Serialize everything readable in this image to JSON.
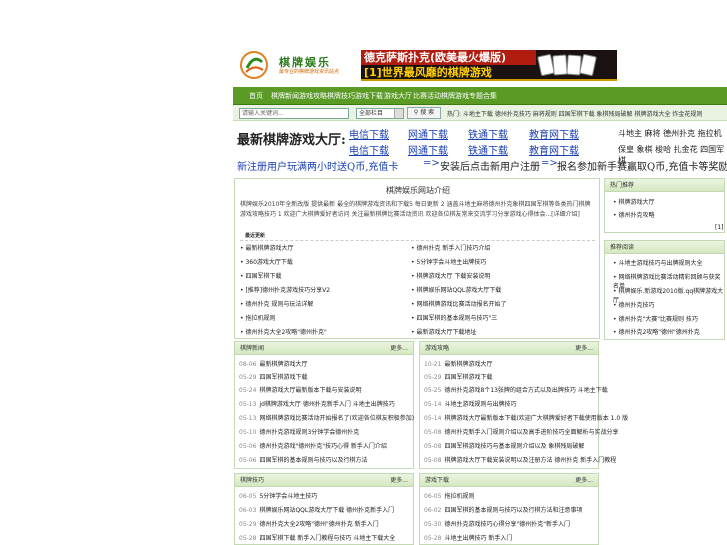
{
  "logo": {
    "name": "棋牌娱乐",
    "tagline": "最专业的棋牌游戏资讯站点"
  },
  "banner": {
    "line1": "德克萨斯扑克(欧美最火爆版)",
    "line2": "[1]世界最风靡的棋牌游戏"
  },
  "nav": {
    "items": [
      "首页",
      "棋牌新闻",
      "游戏攻略",
      "棋牌技巧",
      "游戏下载",
      "游戏大厅",
      "比赛活动",
      "棋牌游戏",
      "专题合集"
    ]
  },
  "search": {
    "placeholder": "请输入关键词...",
    "select_value": "全部栏目",
    "button": "搜 索",
    "hot": "热门: 斗地主下载 德州扑克技巧 麻将规则 四国军棋下载 象棋残局破解 棋牌游戏大全 炸金花规则"
  },
  "downloads": {
    "title": "最新棋牌游戏大厅:",
    "links": [
      "电信下载",
      "网通下载",
      "铁通下载",
      "教育网下载",
      "电信下载",
      "网通下载",
      "铁通下载",
      "教育网下载"
    ],
    "games_row1": "斗地主  麻将  德州扑克  拖拉机",
    "games_row2": "保皇  象棋  梭哈  扎金花  四国军棋"
  },
  "promo": {
    "p1": "新注册用户玩满两小时送Q币,充值卡",
    "arrow": "=>",
    "p2": "安装后点击新用户注册",
    "p3": "报名参加新手赛赢取Q币,充值卡等奖励"
  },
  "intro": {
    "title": "棋牌娱乐网站介绍",
    "text": "棋牌娱乐2010年全新改版 提供最新 最全的棋牌游戏资讯和下载5 每日更新 2 涵盖斗地主麻将德州扑克象棋四国军棋等各类热门棋牌游戏攻略技巧 1 欢迎广大棋牌爱好者访问 关注最新棋牌比赛活动资讯 欢迎各位棋友常来交流学习分享游戏心得体会...[详细介绍]",
    "recent_title": "最近更新",
    "recent": [
      "最新棋牌游戏大厅",
      "德州扑克 新手入门技巧介绍",
      "360游戏大厅下载",
      "5分钟学会斗地主出牌技巧",
      "四国军棋下载",
      "棋牌游戏大厅 下载安装说明",
      "[推荐]德州扑克游戏技巧分享V2",
      "棋牌娱乐网站QQL游戏大厅下载",
      "德州扑克 规则与玩法详解",
      "网络棋牌游戏比赛活动报名开始了",
      "拖拉机规则",
      "四国军棋的基本规则与技巧\"三",
      "德州扑克大全2攻略\"德州扑克\"",
      "最新游戏大厅下载地址"
    ]
  },
  "right1": {
    "title": "热门推荐",
    "items": [
      "棋牌游戏大厅",
      "德州扑克攻略"
    ],
    "page": "[1]"
  },
  "right2": {
    "title": "推荐阅读",
    "items": [
      "斗地主游戏技巧与出牌规则大全",
      "网络棋牌游戏比赛活动精彩回顾与获奖名单",
      "棋牌娱乐.新游戏2010版.qq棋牌游戏大厅",
      "德州扑克技巧",
      "德州扑克\"大赛\"比赛规则 技巧",
      "德州扑克2攻略\"德州\"德州扑克"
    ]
  },
  "news1": {
    "title": "棋牌新闻",
    "more": "更多...",
    "rows": [
      {
        "date": "08-06",
        "text": "最新棋牌游戏大厅"
      },
      {
        "date": "05-29",
        "text": "四国军棋游戏下载"
      },
      {
        "date": "05-24",
        "text": "棋牌游戏大厅最新版本下载与安装说明"
      },
      {
        "date": "05-13",
        "text": "jd棋牌游戏大厅 德州扑克新手入门 斗地主出牌技巧"
      },
      {
        "date": "05-13",
        "text": "网络棋牌游戏比赛活动开始报名了(欢迎各位棋友积极参加)"
      },
      {
        "date": "05-10",
        "text": "德州扑克游戏规则3分钟学会德州扑克"
      },
      {
        "date": "05-06",
        "text": "德州扑克游戏\"德州扑克\"技巧心得 新手入门介绍"
      },
      {
        "date": "05-06",
        "text": "四国军棋的基本规则与技巧以及行棋方法"
      }
    ]
  },
  "news2": {
    "title": "游戏攻略",
    "more": "更多...",
    "rows": [
      {
        "date": "10-21",
        "text": "最新棋牌游戏大厅"
      },
      {
        "date": "05-29",
        "text": "四国军棋游戏下载"
      },
      {
        "date": "05-25",
        "text": "德州扑克游戏8个13张牌的组合方式以及出牌技巧 斗地主下载"
      },
      {
        "date": "05-14",
        "text": "斗地主游戏规则与出牌技巧"
      },
      {
        "date": "05-14",
        "text": "棋牌游戏大厅最新版本下载(欢迎广大棋牌爱好者下载使用版本 1.0 版"
      },
      {
        "date": "05-08",
        "text": "德州扑克新手入门规则介绍以及高手进阶技巧全面解析与实战分享"
      },
      {
        "date": "05-08",
        "text": "四国军棋游戏技巧与基本规则介绍以及 象棋残局破解"
      },
      {
        "date": "05-08",
        "text": "棋牌游戏大厅下载安装说明以及注册方法 德州扑克 新手入门教程"
      }
    ]
  },
  "news3": {
    "title": "棋牌技巧",
    "more": "更多...",
    "rows": [
      {
        "date": "06-05",
        "text": "5分钟学会斗地主技巧"
      },
      {
        "date": "06-03",
        "text": "棋牌娱乐网站QQL游戏大厅下载 德州扑克新手入门"
      },
      {
        "date": "05-29",
        "text": "德州扑克大全2攻略\"德州\"德州扑克 新手入门"
      },
      {
        "date": "05-28",
        "text": "四国军棋下载 新手入门教程与技巧 斗地主下载大全"
      }
    ]
  },
  "news4": {
    "title": "游戏下载",
    "more": "更多...",
    "rows": [
      {
        "date": "06-05",
        "text": "拖拉机规则"
      },
      {
        "date": "06-02",
        "text": "四国军棋的基本规则与技巧以及行棋方法和注意事项"
      },
      {
        "date": "05-30",
        "text": "德州扑克游戏技巧心得分享\"德州扑克\"新手入门"
      },
      {
        "date": "05-28",
        "text": "斗地主出牌技巧 新手入门"
      }
    ]
  }
}
